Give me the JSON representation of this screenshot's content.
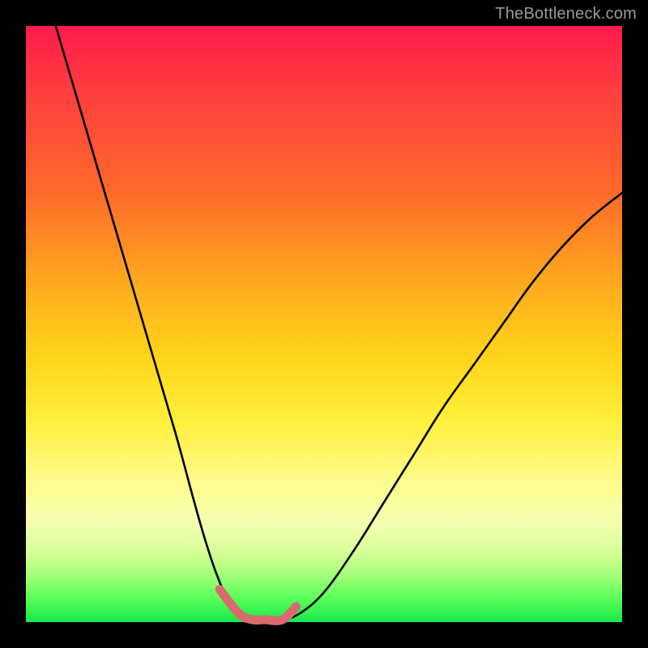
{
  "watermark": "TheBottleneck.com",
  "colors": {
    "frame": "#000000",
    "curve": "#000000",
    "highlight": "#d96a6f",
    "gradient_top": "#ff1a4d",
    "gradient_bottom": "#17e84a"
  },
  "chart_data": {
    "type": "line",
    "title": "",
    "xlabel": "",
    "ylabel": "",
    "xlim": [
      0,
      100
    ],
    "ylim": [
      0,
      100
    ],
    "note": "Axes have no tick labels or numeric scale in the image; x/y are normalized 0–100. Curve is a V-shaped bottleneck profile; values below are estimated from pixel positions.",
    "series": [
      {
        "name": "bottleneck-curve",
        "x": [
          5,
          10,
          15,
          20,
          25,
          28,
          30,
          32,
          34,
          36,
          38,
          40,
          43,
          46,
          50,
          55,
          60,
          65,
          70,
          75,
          80,
          85,
          90,
          95,
          100
        ],
        "y": [
          100,
          83,
          66,
          49,
          32,
          21,
          14,
          8,
          3.5,
          1.2,
          0.4,
          0.4,
          0.4,
          1.5,
          5,
          12,
          20,
          28,
          36,
          43,
          50,
          57,
          63,
          68,
          72
        ]
      }
    ],
    "highlight_segment": {
      "name": "valley-highlight",
      "x": [
        32.5,
        34,
        36,
        38,
        40,
        43,
        45.3
      ],
      "y": [
        5.5,
        3.5,
        1.2,
        0.4,
        0.4,
        0.4,
        2.6
      ]
    }
  }
}
